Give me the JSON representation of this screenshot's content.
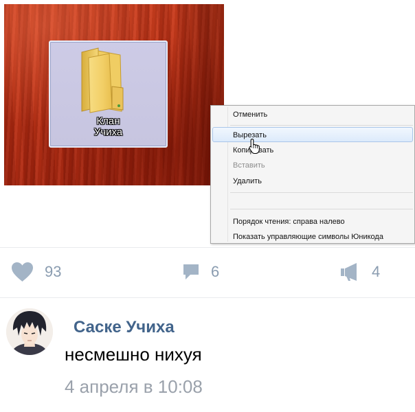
{
  "desktop": {
    "folder": {
      "label_line1": "Клан",
      "label_line2": "Учиха",
      "icon": "folder-icon"
    }
  },
  "context_menu": {
    "items": [
      {
        "label": "Отменить",
        "state": "normal"
      },
      {
        "label": "Вырезать",
        "state": "highlighted"
      },
      {
        "label": "Копировать",
        "state": "normal"
      },
      {
        "label": "Вставить",
        "state": "disabled"
      },
      {
        "label": "Удалить",
        "state": "normal"
      },
      {
        "label": "Порядок чтения: справа налево",
        "state": "normal"
      },
      {
        "label": "Показать управляющие символы Юникода",
        "state": "normal"
      }
    ],
    "cursor": "hand-pointer-icon"
  },
  "actions": {
    "likes": {
      "icon": "heart-icon",
      "count": "93"
    },
    "comments": {
      "icon": "comment-bubble-icon",
      "count": "6"
    },
    "reposts": {
      "icon": "megaphone-icon",
      "count": "4"
    }
  },
  "comment": {
    "author": "Саске Учиха",
    "text": "несмешно нихуя",
    "date": "4 апреля в 10:08"
  },
  "colors": {
    "author_link": "#42648b",
    "action_icon": "#a3b4c6",
    "date_text": "#9aa1ab",
    "desktop_red": "#b72e14"
  }
}
